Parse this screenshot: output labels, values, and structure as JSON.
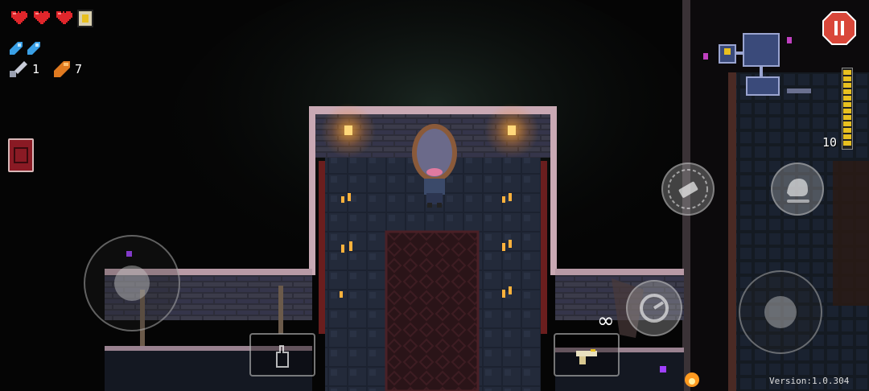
{
  "hud": {
    "health": {
      "full_hearts": 3,
      "armor": 1
    },
    "blanks": 2,
    "keys": {
      "icon": "key-icon",
      "count": "1"
    },
    "shells": {
      "icon": "shell-casing-icon",
      "count": "7"
    },
    "ammo": {
      "count": "10"
    },
    "infinite_ammo_symbol": "∞",
    "version": "Version:1.0.304"
  },
  "colors": {
    "pause_button": "#d9473a",
    "heart": "#e0262b",
    "blank": "#3aa0e6",
    "ammo_bar": "#e8c020",
    "torch": "#ffb23c"
  },
  "controls": {
    "pause": "pause-icon",
    "item_slot": "item-glove-icon",
    "weapon_slot": "pistol-icon",
    "reload": "reload-icon",
    "dodge": "dodge-roll-icon",
    "interact": "interact-hand-icon"
  }
}
